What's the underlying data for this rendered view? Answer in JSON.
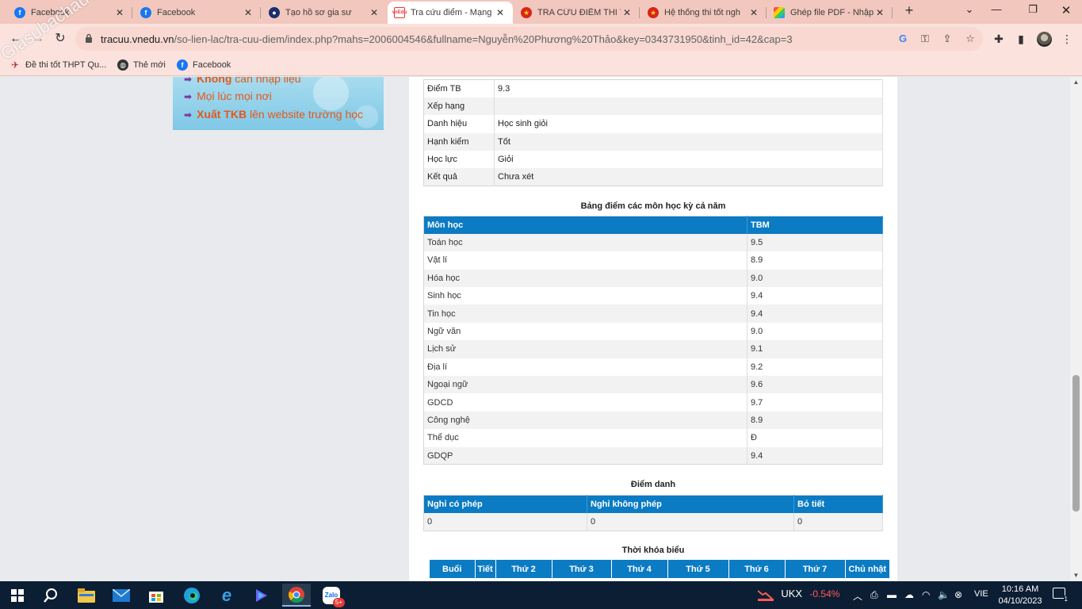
{
  "tabs": [
    {
      "label": "Facebook",
      "icon": "facebook-icon"
    },
    {
      "label": "Facebook",
      "icon": "facebook-icon"
    },
    {
      "label": "Tạo hồ sơ gia sư",
      "icon": "site-icon"
    },
    {
      "label": "Tra cứu điểm - Mạng",
      "icon": "vnedu-icon",
      "active": true
    },
    {
      "label": "TRA CỨU ĐIỂM THI T",
      "icon": "emblem-icon"
    },
    {
      "label": "Hệ thống thi tốt ngh",
      "icon": "emblem-icon"
    },
    {
      "label": "Ghép file PDF - Nhập",
      "icon": "pdf-icon"
    }
  ],
  "address": {
    "domain": "tracuu.vnedu.vn",
    "path": "/so-lien-lac/tra-cuu-diem/index.php?mahs=2006004546&fullname=Nguyễn%20Phương%20Thảo&key=0343731950&tinh_id=42&cap=3"
  },
  "bookmarks": [
    {
      "label": "Đề thi tốt THPT Qu..."
    },
    {
      "label": "Thẻ mới"
    },
    {
      "label": "Facebook"
    }
  ],
  "watermark": "Giasubachau.net",
  "banner": {
    "lines": [
      {
        "bold": "Không",
        "rest": " cần nhập liệu"
      },
      {
        "bold": "",
        "rest": "Mọi lúc mọi nơi"
      },
      {
        "bold": "Xuất TKB",
        "rest": " lên website trường học"
      }
    ]
  },
  "summary": [
    {
      "label": "Điểm TB",
      "value": "9.3"
    },
    {
      "label": "Xếp hạng",
      "value": ""
    },
    {
      "label": "Danh hiệu",
      "value": "Học sinh giỏi"
    },
    {
      "label": "Hạnh kiểm",
      "value": "Tốt"
    },
    {
      "label": "Học lực",
      "value": "Giỏi"
    },
    {
      "label": "Kết quả",
      "value": "Chưa xét"
    }
  ],
  "grades": {
    "title": "Bảng điểm các môn học kỳ cả năm",
    "headers": [
      "Môn học",
      "TBM"
    ],
    "rows": [
      [
        "Toán học",
        "9.5"
      ],
      [
        "Vật lí",
        "8.9"
      ],
      [
        "Hóa học",
        "9.0"
      ],
      [
        "Sinh học",
        "9.4"
      ],
      [
        "Tin học",
        "9.4"
      ],
      [
        "Ngữ văn",
        "9.0"
      ],
      [
        "Lịch sử",
        "9.1"
      ],
      [
        "Địa lí",
        "9.2"
      ],
      [
        "Ngoại ngữ",
        "9.6"
      ],
      [
        "GDCD",
        "9.7"
      ],
      [
        "Công nghệ",
        "8.9"
      ],
      [
        "Thể dục",
        " Đ"
      ],
      [
        "GDQP",
        "9.4"
      ]
    ]
  },
  "attendance": {
    "title": "Điểm danh",
    "headers": [
      "Nghỉ có phép",
      "Nghỉ không phép",
      "Bỏ tiết"
    ],
    "values": [
      "0",
      "0",
      "0"
    ]
  },
  "timetable": {
    "title": "Thời khóa biểu",
    "headers": [
      "Buổi",
      "Tiết",
      "Thứ 2",
      "Thứ 3",
      "Thứ 4",
      "Thứ 5",
      "Thứ 6",
      "Thứ 7",
      "Chủ nhật"
    ]
  },
  "taskbar": {
    "stock_name": "UKX",
    "stock_change": "-0.54%",
    "language": "VIE",
    "time": "10:16 AM",
    "date": "04/10/2023",
    "notification_count": "1",
    "zalo_badge": "5+"
  },
  "colors": {
    "tab_strip": "#f2c7bd",
    "header_blue": "#0b7bc3",
    "stock_negative": "#ff5a5a"
  }
}
